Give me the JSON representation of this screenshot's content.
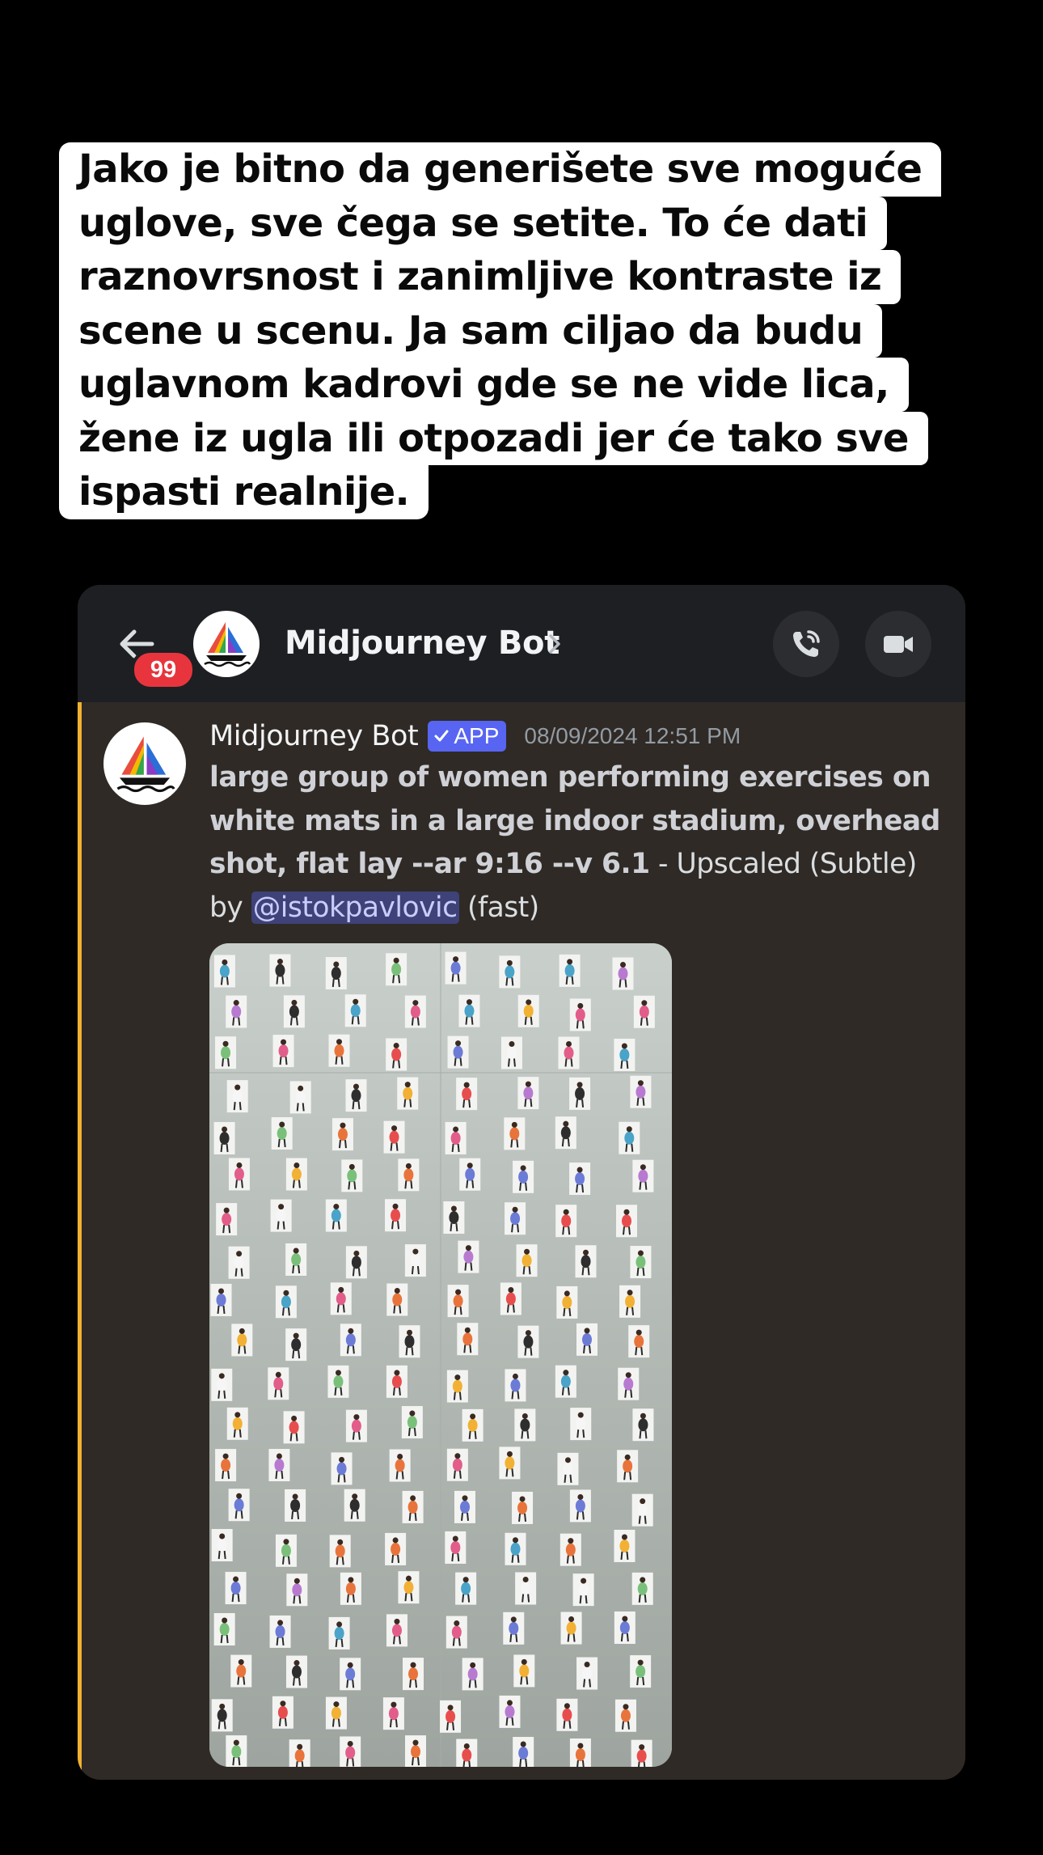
{
  "caption": {
    "lines": [
      "Jako je bitno da generišete sve moguće",
      "uglove, sve čega se setite. To će dati",
      "raznovrsnost i zanimljive kontraste iz",
      "scene u scenu. Ja sam ciljao da budu",
      "uglavnom kadrovi gde se ne vide lica,",
      "žene iz ugla ili otpozadi jer će tako sve",
      "ispasti realnije."
    ]
  },
  "header": {
    "unread_count": "99",
    "title": "Midjourney Bot",
    "back_icon": "arrow-left-icon",
    "chevron_icon": "chevron-right-icon",
    "call_icon": "phone-call-icon",
    "video_icon": "video-camera-icon"
  },
  "message": {
    "author": "Midjourney Bot",
    "app_tag": "APP",
    "timestamp": "08/09/2024 12:51 PM",
    "prompt_lines": [
      "large group of women performing exercises on",
      "white mats in a large indoor stadium, overhead",
      "shot, flat lay --ar 9:16 --v 6.1"
    ],
    "suffix": " - Upscaled (Subtle)",
    "by_label": "by ",
    "mention": "@istokpavlovic",
    "speed": " (fast)"
  },
  "colors": {
    "accent_bar": "#f0b132",
    "app_tag": "#5865f2",
    "badge": "#e8353d",
    "mention_bg": "#3e4278",
    "card_bg": "#2f2a25",
    "header_bg": "#1e1f23"
  }
}
